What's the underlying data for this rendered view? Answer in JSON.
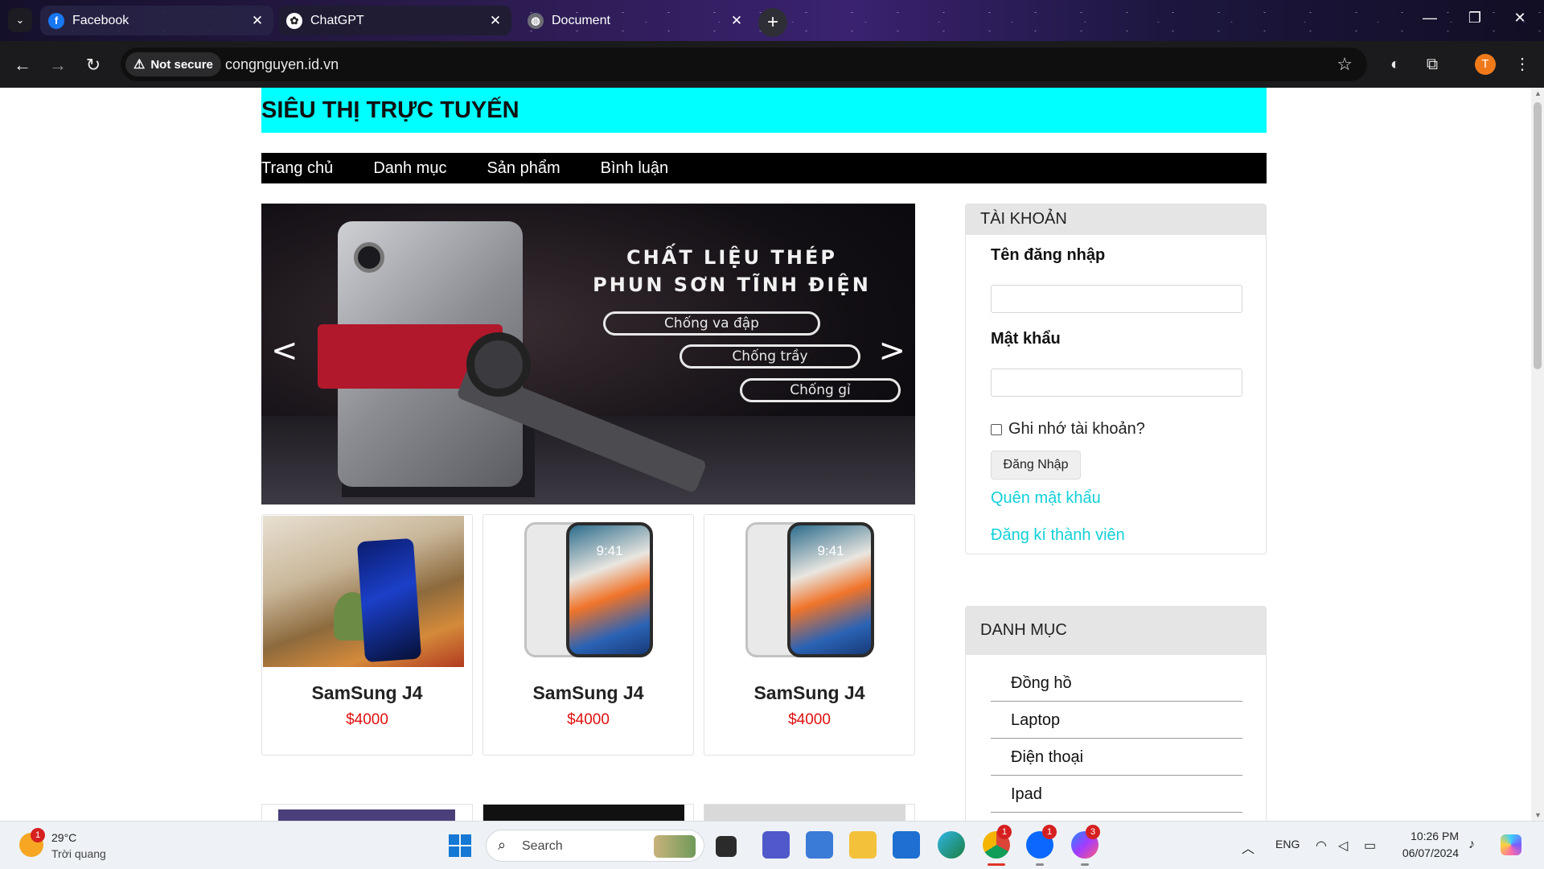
{
  "browser": {
    "tabs": [
      {
        "title": "Facebook",
        "favicon": "facebook-icon"
      },
      {
        "title": "ChatGPT",
        "favicon": "chatgpt-icon"
      },
      {
        "title": "Document",
        "favicon": "globe-icon"
      }
    ],
    "security_chip": "Not secure",
    "url": "congnguyen.id.vn",
    "profile_initial": "T"
  },
  "page": {
    "site_title": "SIÊU THỊ TRỰC TUYẾN",
    "nav": [
      "Trang chủ",
      "Danh mục",
      "Sản phẩm",
      "Bình luận"
    ],
    "slider": {
      "headline_1": "CHẤT LIỆU THÉP",
      "headline_2": "PHUN SƠN TĨNH ĐIỆN",
      "pill_1": "Chống va đập",
      "pill_2": "Chống trầy",
      "pill_3": "Chống gỉ",
      "prev": "<",
      "next": ">"
    },
    "products": [
      {
        "name": "SamSung J4",
        "price": "$4000",
        "image": "realme-phone-image"
      },
      {
        "name": "SamSung J4",
        "price": "$4000",
        "image": "iphone-x-image",
        "screen_time": "9:41"
      },
      {
        "name": "SamSung J4",
        "price": "$4000",
        "image": "iphone-x-image",
        "screen_time": "9:41"
      }
    ],
    "account": {
      "header": "TÀI KHOẢN",
      "username_label": "Tên đăng nhập",
      "password_label": "Mật khẩu",
      "remember_label": "Ghi nhớ tài khoản?",
      "login_button": "Đăng Nhập",
      "forgot_link": "Quên mật khẩu",
      "register_link": "Đăng kí thành viên"
    },
    "category": {
      "header": "DANH MỤC",
      "items": [
        "Đồng hồ",
        "Laptop",
        "Điện thoại",
        "Ipad"
      ]
    }
  },
  "taskbar": {
    "weather_temp": "29°C",
    "weather_desc": "Trời quang",
    "weather_badge": "1",
    "search_placeholder": "Search",
    "chrome_badge": "1",
    "zalo_badge": "1",
    "messenger_badge": "3",
    "language": "ENG",
    "time": "10:26 PM",
    "date": "06/07/2024"
  },
  "colors": {
    "header_bg": "#00ffff",
    "nav_bg": "#000000",
    "price": "#e01010",
    "link": "#12d0d8"
  }
}
